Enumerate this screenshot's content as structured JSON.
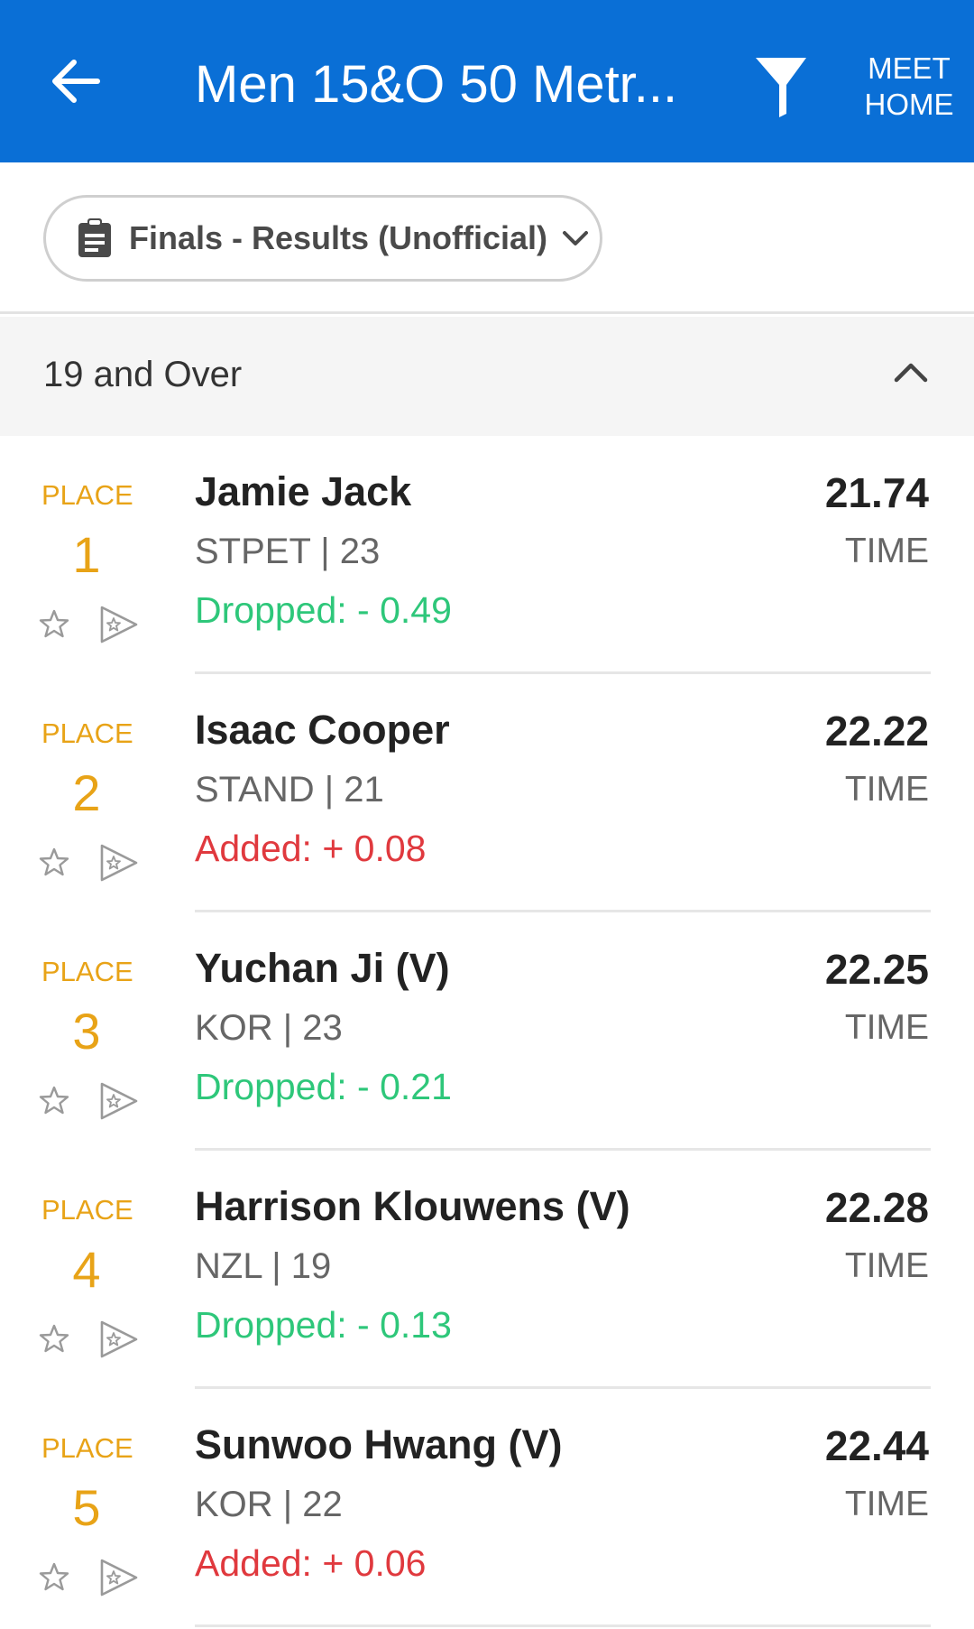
{
  "header": {
    "title": "Men 15&O 50 Metr...",
    "meet_home_line1": "MEET",
    "meet_home_line2": "HOME",
    "back_icon": "arrow-left-icon",
    "filter_icon": "filter-icon"
  },
  "session": {
    "label": "Finals - Results (Unofficial)",
    "icon": "clipboard-icon",
    "dropdown_icon": "chevron-down-icon"
  },
  "group": {
    "title": "19 and Over",
    "collapse_icon": "chevron-up-icon"
  },
  "results": [
    {
      "place_label": "PLACE",
      "place": "1",
      "name": "Jamie Jack",
      "meta": "STPET | 23",
      "delta": "Dropped: - 0.49",
      "delta_type": "drop",
      "time": "21.74",
      "time_label": "TIME"
    },
    {
      "place_label": "PLACE",
      "place": "2",
      "name": "Isaac Cooper",
      "meta": "STAND | 21",
      "delta": "Added: + 0.08",
      "delta_type": "add",
      "time": "22.22",
      "time_label": "TIME"
    },
    {
      "place_label": "PLACE",
      "place": "3",
      "name": "Yuchan Ji (V)",
      "meta": "KOR | 23",
      "delta": "Dropped: - 0.21",
      "delta_type": "drop",
      "time": "22.25",
      "time_label": "TIME"
    },
    {
      "place_label": "PLACE",
      "place": "4",
      "name": "Harrison Klouwens (V)",
      "meta": "NZL | 19",
      "delta": "Dropped: - 0.13",
      "delta_type": "drop",
      "time": "22.28",
      "time_label": "TIME"
    },
    {
      "place_label": "PLACE",
      "place": "5",
      "name": "Sunwoo Hwang (V)",
      "meta": "KOR | 22",
      "delta": "Added: + 0.06",
      "delta_type": "add",
      "time": "22.44",
      "time_label": "TIME"
    }
  ],
  "colors": {
    "header_bg": "#0a6fd6",
    "place": "#e8a317",
    "dropped": "#2ec77a",
    "added": "#e0393e"
  }
}
